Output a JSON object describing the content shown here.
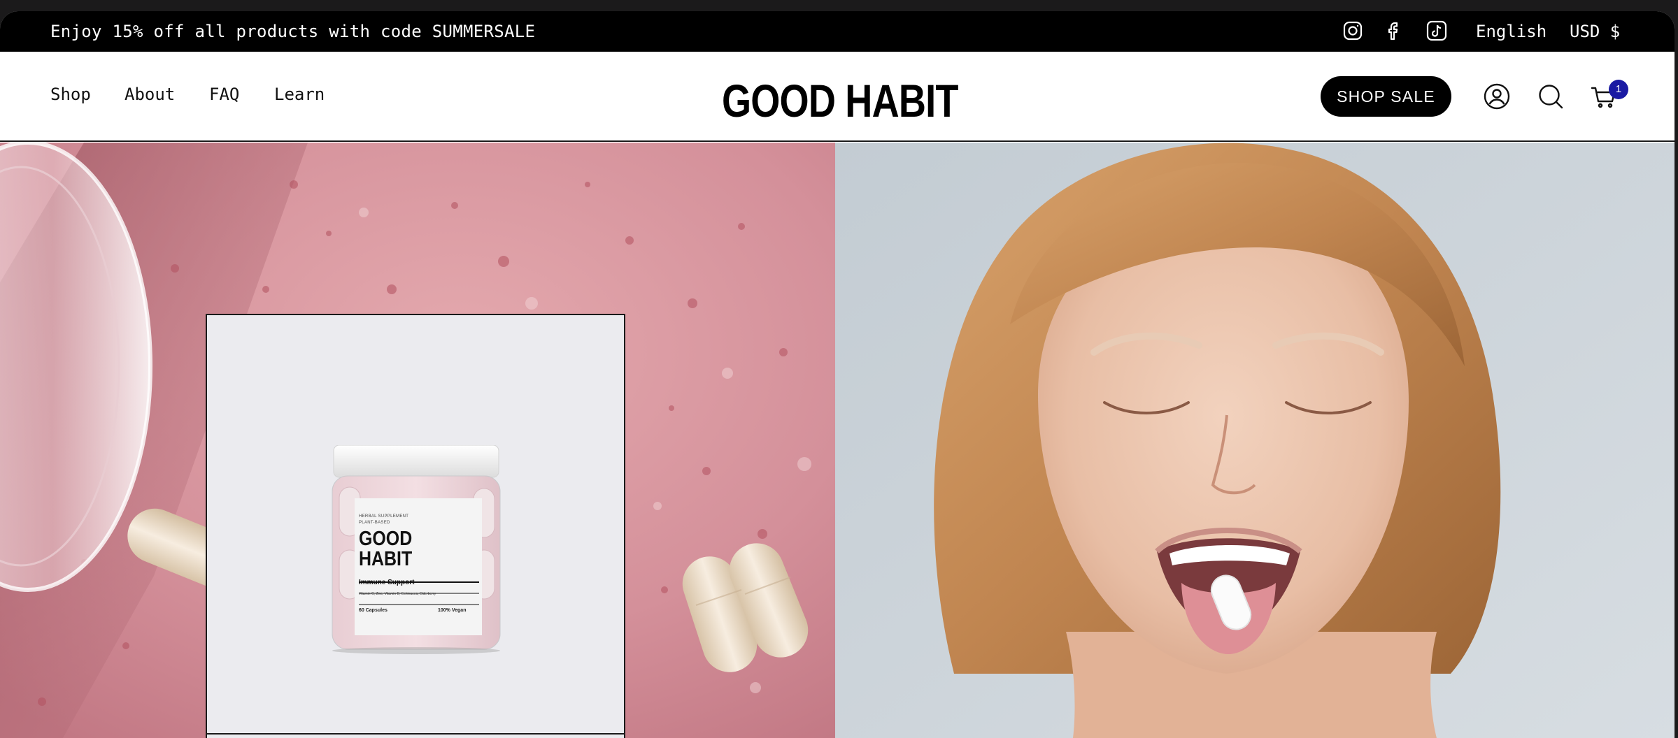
{
  "announcement": {
    "text": "Enjoy 15% off all products with code SUMMERSALE",
    "social": [
      "instagram-icon",
      "facebook-icon",
      "tiktok-icon"
    ],
    "language": "English",
    "currency": "USD $"
  },
  "header": {
    "nav": [
      "Shop",
      "About",
      "FAQ",
      "Learn"
    ],
    "logo": "GOOD HABIT",
    "cta": "SHOP SALE",
    "icons": [
      "account-icon",
      "search-icon",
      "cart-icon"
    ],
    "cart_count": "1",
    "colors": {
      "badge": "#1a1aa3",
      "cta_bg": "#000000"
    }
  },
  "hero": {
    "product": {
      "eyebrow": "HERBAL SUPPLEMENT\nPLANT-BASED",
      "brand": "GOOD\nHABIT",
      "name": "Immune Support",
      "ingredients": "Vitamin C, Zinc, Vitamin D, Echinacea, Elderberry",
      "count": "60 Capsules",
      "badge": "100% Vegan"
    }
  }
}
